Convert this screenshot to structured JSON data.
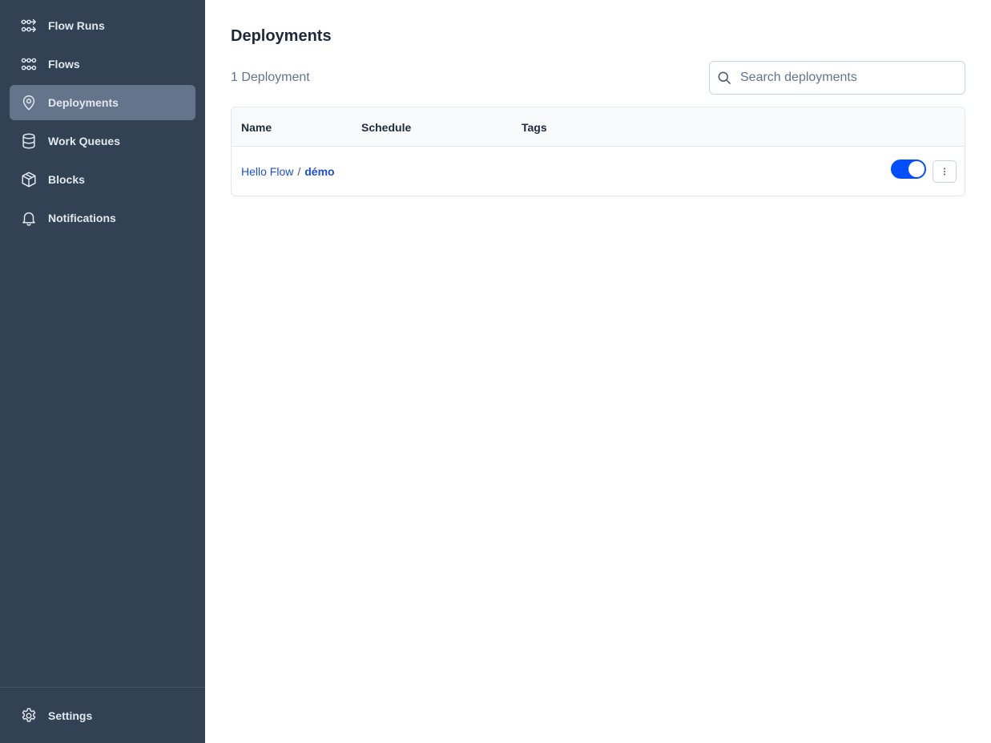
{
  "sidebar": {
    "items": [
      {
        "label": "Flow Runs",
        "icon": "flow-runs-icon",
        "active": false
      },
      {
        "label": "Flows",
        "icon": "flows-icon",
        "active": false
      },
      {
        "label": "Deployments",
        "icon": "map-pin-icon",
        "active": true
      },
      {
        "label": "Work Queues",
        "icon": "database-icon",
        "active": false
      },
      {
        "label": "Blocks",
        "icon": "cube-icon",
        "active": false
      },
      {
        "label": "Notifications",
        "icon": "bell-icon",
        "active": false
      }
    ],
    "settings": {
      "label": "Settings",
      "icon": "gear-icon"
    }
  },
  "main": {
    "title": "Deployments",
    "count": "1 Deployment",
    "search": {
      "placeholder": "Search deployments",
      "value": ""
    },
    "table": {
      "columns": [
        "Name",
        "Schedule",
        "Tags"
      ],
      "rows": [
        {
          "flow": "Hello Flow",
          "separator": "/",
          "deployment": "démo",
          "schedule": "",
          "tags": "",
          "active": true
        }
      ]
    }
  },
  "colors": {
    "sidebar_bg": "#334155",
    "active_item_bg": "#64748b",
    "link": "#1d4ed8",
    "toggle_on": "#024dfd"
  }
}
